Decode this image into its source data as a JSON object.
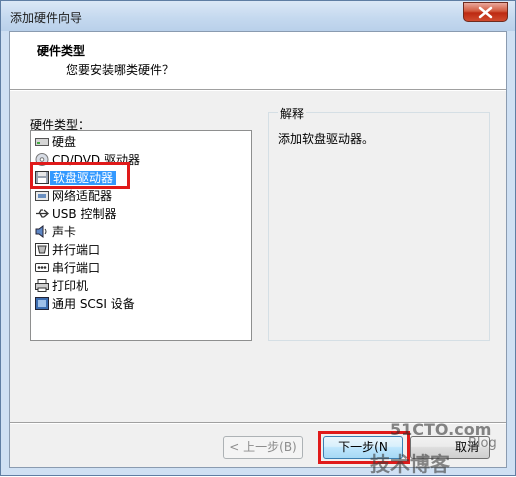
{
  "window": {
    "title": "添加硬件向导"
  },
  "header": {
    "title": "硬件类型",
    "subtitle": "您要安装哪类硬件？"
  },
  "hardware_list": {
    "label": "硬件类型：",
    "selected_index": 2,
    "items": [
      {
        "label": "硬盘",
        "icon": "hard-disk-icon"
      },
      {
        "label": "CD/DVD 驱动器",
        "icon": "cd-dvd-icon"
      },
      {
        "label": "软盘驱动器",
        "icon": "floppy-icon"
      },
      {
        "label": "网络适配器",
        "icon": "network-adapter-icon"
      },
      {
        "label": "USB 控制器",
        "icon": "usb-icon"
      },
      {
        "label": "声卡",
        "icon": "sound-card-icon"
      },
      {
        "label": "并行端口",
        "icon": "parallel-port-icon"
      },
      {
        "label": "串行端口",
        "icon": "serial-port-icon"
      },
      {
        "label": "打印机",
        "icon": "printer-icon"
      },
      {
        "label": "通用 SCSI 设备",
        "icon": "scsi-icon"
      }
    ]
  },
  "explanation": {
    "title": "解释",
    "text": "添加软盘驱动器。"
  },
  "buttons": {
    "back": "< 上一步(B)",
    "next": "下一步(N",
    "cancel": "取消"
  },
  "watermark": {
    "line1": "51CTO.com",
    "line2": "技术博客",
    "line3": "Blog"
  },
  "colors": {
    "selection": "#3399ff",
    "highlight_box": "#e01a1a"
  }
}
